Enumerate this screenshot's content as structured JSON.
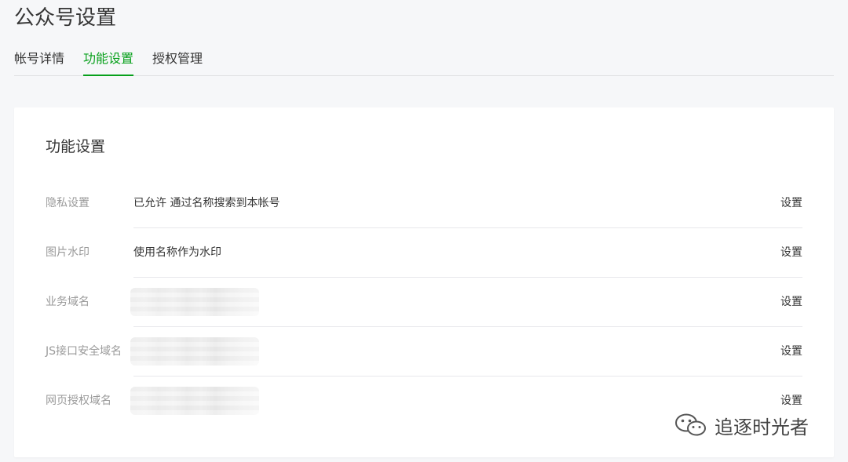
{
  "header": {
    "title": "公众号设置"
  },
  "tabs": [
    {
      "label": "帐号详情",
      "active": false
    },
    {
      "label": "功能设置",
      "active": true
    },
    {
      "label": "授权管理",
      "active": false
    }
  ],
  "card": {
    "title": "功能设置",
    "rows": [
      {
        "label": "隐私设置",
        "value": "已允许 通过名称搜索到本帐号",
        "action": "设置"
      },
      {
        "label": "图片水印",
        "value": "使用名称作为水印",
        "action": "设置"
      },
      {
        "label": "业务域名",
        "value": "",
        "action": "设置"
      },
      {
        "label": "JS接口安全域名",
        "value": "",
        "action": "设置"
      },
      {
        "label": "网页授权域名",
        "value": "",
        "action": "设置"
      }
    ]
  },
  "watermark": {
    "icon": "wechat-icon",
    "text": "追逐时光者"
  },
  "colors": {
    "accent": "#07a01b",
    "background": "#f6f7f9",
    "card": "#ffffff",
    "label": "#9a9a9a",
    "text": "#353535"
  }
}
